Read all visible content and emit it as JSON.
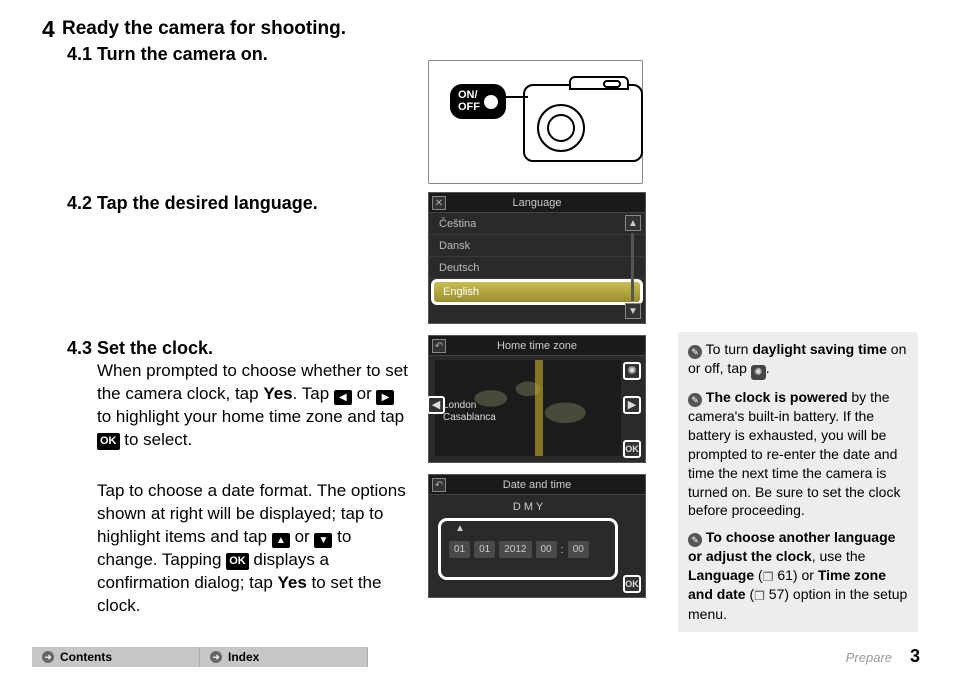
{
  "step": {
    "number": "4",
    "title": "Ready the camera for shooting.",
    "sub41_num": "4.1",
    "sub41_txt": "Turn the camera on.",
    "sub42_num": "4.2",
    "sub42_txt": "Tap the desired language.",
    "sub43_num": "4.3",
    "sub43_txt": "Set the clock."
  },
  "onoff": "ON/\nOFF",
  "body43a_pre": "When prompted to choose whether to set the camera clock, tap ",
  "body43a_yes": "Yes",
  "body43a_tap": ". Tap ",
  "body43a_or": " or ",
  "body43a_mid": " to highlight your home time zone and tap ",
  "body43a_end": " to select.",
  "body43b_pre": "Tap to choose a date format. The options shown at right will be displayed; tap to highlight items and tap ",
  "body43b_or": " or ",
  "body43b_mid": " to change. Tapping ",
  "body43b_post": " displays a confirmation dialog; tap ",
  "body43b_yes": "Yes",
  "body43b_end": " to set the clock.",
  "screens": {
    "language": {
      "title": "Language",
      "items": [
        "Čeština",
        "Dansk",
        "Deutsch",
        "English"
      ]
    },
    "timezone": {
      "title": "Home time zone",
      "city1": "London",
      "city2": "Casablanca",
      "ok": "OK"
    },
    "datetime": {
      "title": "Date and time",
      "format": "D M Y",
      "d": "01",
      "m": "01",
      "y": "2012",
      "h": "00",
      "colon": ":",
      "min": "00",
      "ok": "OK"
    }
  },
  "sidebar": {
    "n1_pre": " To turn ",
    "n1_bold": "daylight saving time",
    "n1_post": " on or off, tap ",
    "n1_end": ".",
    "n2_bold": "The clock is powered",
    "n2_body": " by the camera's built-in battery. If the battery is exhausted, you will be prompted to re-enter the date and time the next time the camera is turned on. Be sure to set the clock before proceeding.",
    "n3_bold": "To choose another language or adjust the clock",
    "n3_mid": ", use the ",
    "n3_lang": "Language",
    "n3_p61": " 61) or ",
    "n3_tzd": "Time zone and date",
    "n3_p57": " 57) option in the setup menu.",
    "open_paren": " ("
  },
  "footer": {
    "contents": "Contents",
    "index": "Index",
    "section": "Prepare",
    "page": "3"
  },
  "glyph": {
    "left": "◀",
    "right": "▶",
    "up": "▲",
    "down": "▼",
    "ok": "OK"
  },
  "chart_data": null
}
